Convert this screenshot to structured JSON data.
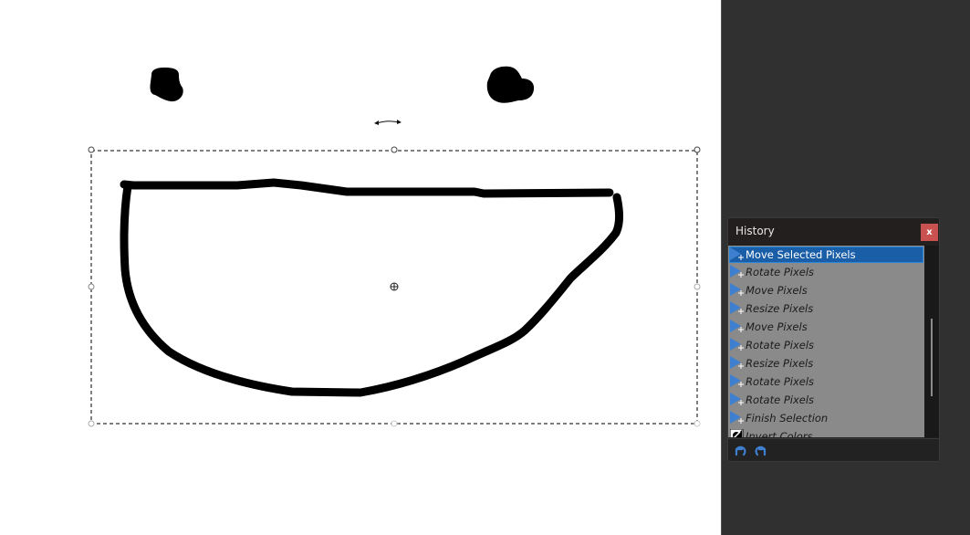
{
  "history_panel": {
    "title": "History",
    "close_label": "x",
    "items": [
      {
        "label": "Move Selected Pixels",
        "icon": "move-selection-icon",
        "selected": true
      },
      {
        "label": "Rotate Pixels",
        "icon": "move-selection-icon",
        "selected": false
      },
      {
        "label": "Move Pixels",
        "icon": "move-selection-icon",
        "selected": false
      },
      {
        "label": "Resize Pixels",
        "icon": "move-selection-icon",
        "selected": false
      },
      {
        "label": "Move Pixels",
        "icon": "move-selection-icon",
        "selected": false
      },
      {
        "label": "Rotate Pixels",
        "icon": "move-selection-icon",
        "selected": false
      },
      {
        "label": "Resize Pixels",
        "icon": "move-selection-icon",
        "selected": false
      },
      {
        "label": "Rotate Pixels",
        "icon": "move-selection-icon",
        "selected": false
      },
      {
        "label": "Rotate Pixels",
        "icon": "move-selection-icon",
        "selected": false
      },
      {
        "label": "Finish Selection",
        "icon": "move-selection-icon",
        "selected": false
      },
      {
        "label": "Invert Colors",
        "icon": "invert-colors-icon",
        "selected": false
      }
    ],
    "footer": {
      "undo_icon": "undo-icon",
      "redo_icon": "redo-icon"
    }
  },
  "colors": {
    "selected_item_bg": "#1b5ea8",
    "close_button_bg": "#c9514f",
    "icon_blue": "#3f7fd0",
    "workspace_bg": "#303030",
    "list_bg": "#8a8a8a"
  }
}
